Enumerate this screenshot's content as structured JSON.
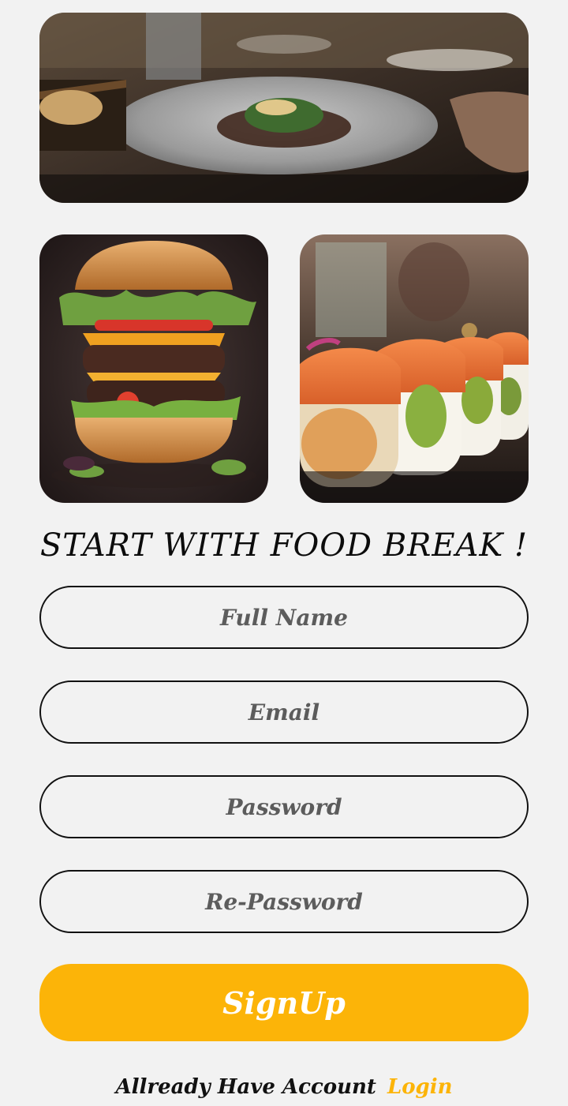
{
  "images": {
    "restaurant": "restaurant-plated-dish-photo",
    "burger": "burger-photo",
    "sushi": "sushi-rolls-photo"
  },
  "headline": "START  WITH FOOD BREAK !",
  "form": {
    "fullname_placeholder": "Full Name",
    "email_placeholder": "Email",
    "password_placeholder": "Password",
    "repassword_placeholder": "Re-Password",
    "signup_label": "SignUp"
  },
  "footer": {
    "prompt": "Allready Have Account",
    "login_label": "Login"
  },
  "colors": {
    "background": "#f2f2f2",
    "accent": "#fcb408",
    "text": "#111111"
  }
}
